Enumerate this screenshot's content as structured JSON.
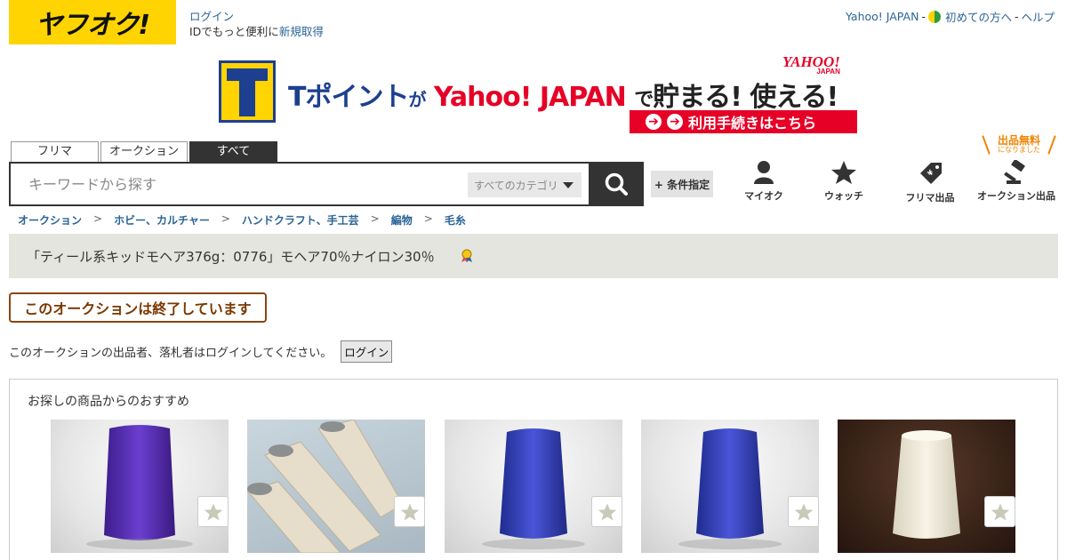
{
  "header": {
    "logo_text": "ヤフオク!",
    "login_link": "ログイン",
    "login_prompt": "IDでもっと便利に",
    "signup_link": "新規取得",
    "top_nav": {
      "yahoo_japan": "Yahoo! JAPAN",
      "sep1": "-",
      "beginners": "初めての方へ",
      "sep2": "-",
      "help": "ヘルプ"
    }
  },
  "banner": {
    "title_tpoint": "Tポイント",
    "title_ga": "が",
    "title_yahoo": "Yahoo! JAPAN",
    "title_de": "で",
    "title_tail": "貯まる! 使える!",
    "yahoo_mini": "YAHOO!",
    "yahoo_mini_sub": "JAPAN",
    "button_label": "利用手続きはこちら"
  },
  "search": {
    "tabs": [
      "フリマ",
      "オークション",
      "すべて"
    ],
    "active_tab": "すべて",
    "placeholder": "キーワードから探す",
    "category_label": "すべてのカテゴリ",
    "conditions_label": "+ 条件指定"
  },
  "nav_icons": {
    "free_badge": "出品無料",
    "free_badge_sub": "になりました",
    "myauc": "マイオク",
    "watch": "ウォッチ",
    "flima_sell": "フリマ出品",
    "auction_sell": "オークション出品"
  },
  "breadcrumb": [
    "オークション",
    "ホビー、カルチャー",
    "ハンドクラフト、手工芸",
    "編物",
    "毛糸"
  ],
  "breadcrumb_sep": ">",
  "item": {
    "title": "「ティール系キッドモヘア376g：0776」モヘア70％ナイロン30％"
  },
  "status": {
    "ended_label": "このオークションは終了しています",
    "login_notice": "このオークションの出品者、落札者はログインしてください。",
    "login_button": "ログイン"
  },
  "recommend": {
    "title": "お探しの商品からのおすすめ"
  },
  "colors": {
    "yahuoku_yellow": "#ffd400",
    "link_blue": "#2a6496",
    "tpoint_blue": "#1d3f8f",
    "yahoo_red": "#e60026",
    "ended_brown": "#8b4513",
    "free_orange": "#f08300"
  }
}
